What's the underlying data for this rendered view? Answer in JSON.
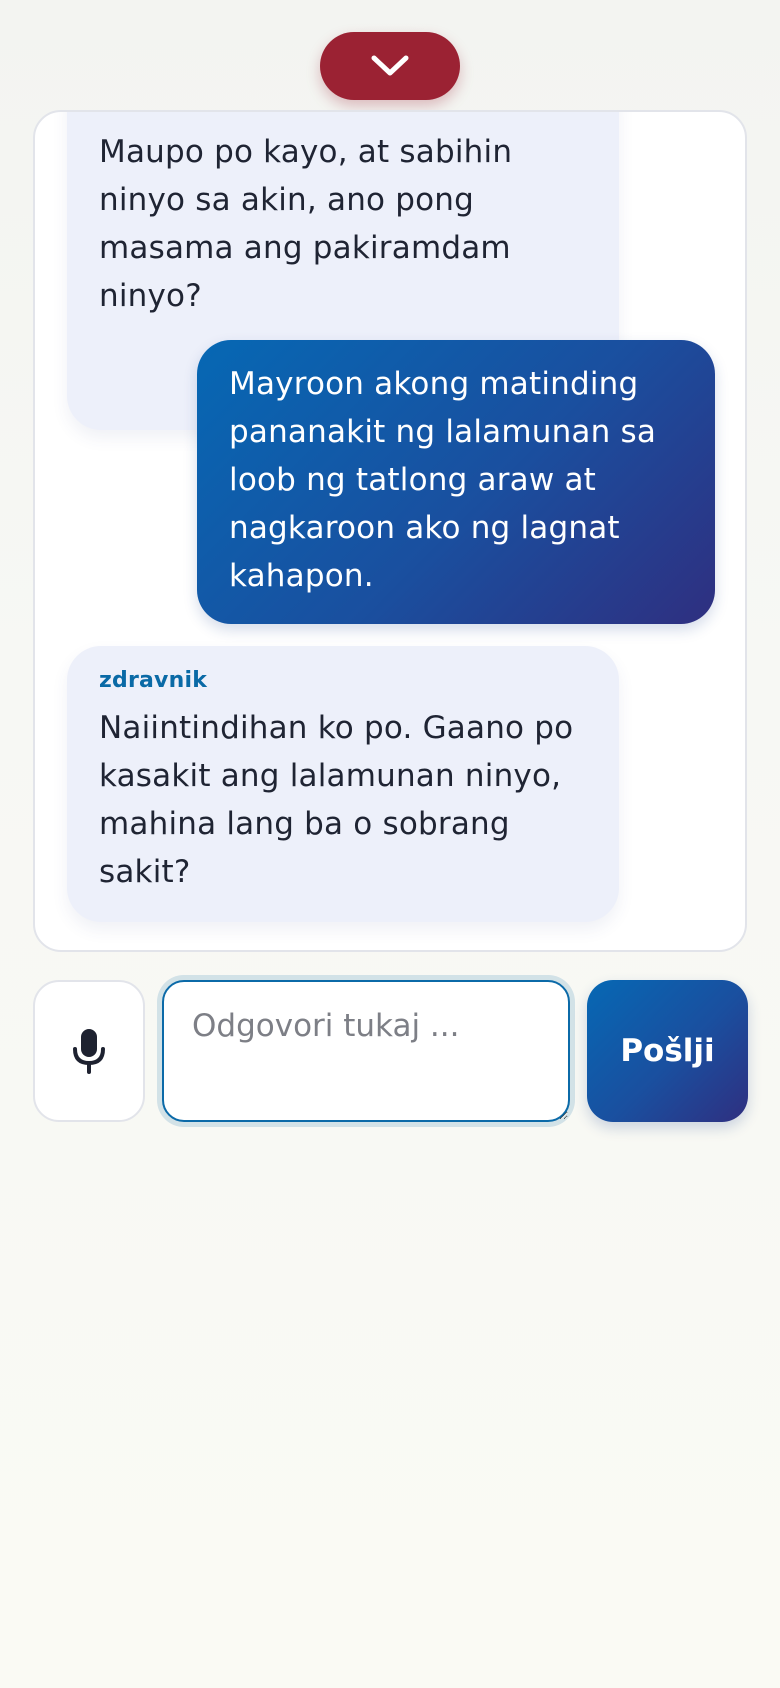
{
  "chat": {
    "messages": [
      {
        "role": "doctor",
        "sender": "",
        "text": "Maupo po kayo, at sabihin ninyo sa akin, ano pong masama ang pakiramdam ninyo?"
      },
      {
        "role": "patient",
        "text": "Mayroon akong matinding pananakit ng lalamunan sa loob ng tatlong araw at nagkaroon ako ng lagnat kahapon."
      },
      {
        "role": "doctor",
        "sender": "zdravnik",
        "text": "Naiintindihan ko po. Gaano po kasakit ang lalamunan ninyo, mahina lang ba o sobrang sakit?"
      }
    ]
  },
  "composer": {
    "input_value": "",
    "input_placeholder": "Odgovori tukaj ...",
    "send_label": "Pošlji",
    "mic_icon": "microphone-icon"
  },
  "header": {
    "collapse_icon": "chevron-down-icon"
  },
  "colors": {
    "accent_red": "#9b2233",
    "primary_blue": "#0668b4",
    "primary_indigo": "#2f2f80",
    "doctor_bubble": "#edf0fa",
    "sender_label": "#0a6aa6"
  }
}
